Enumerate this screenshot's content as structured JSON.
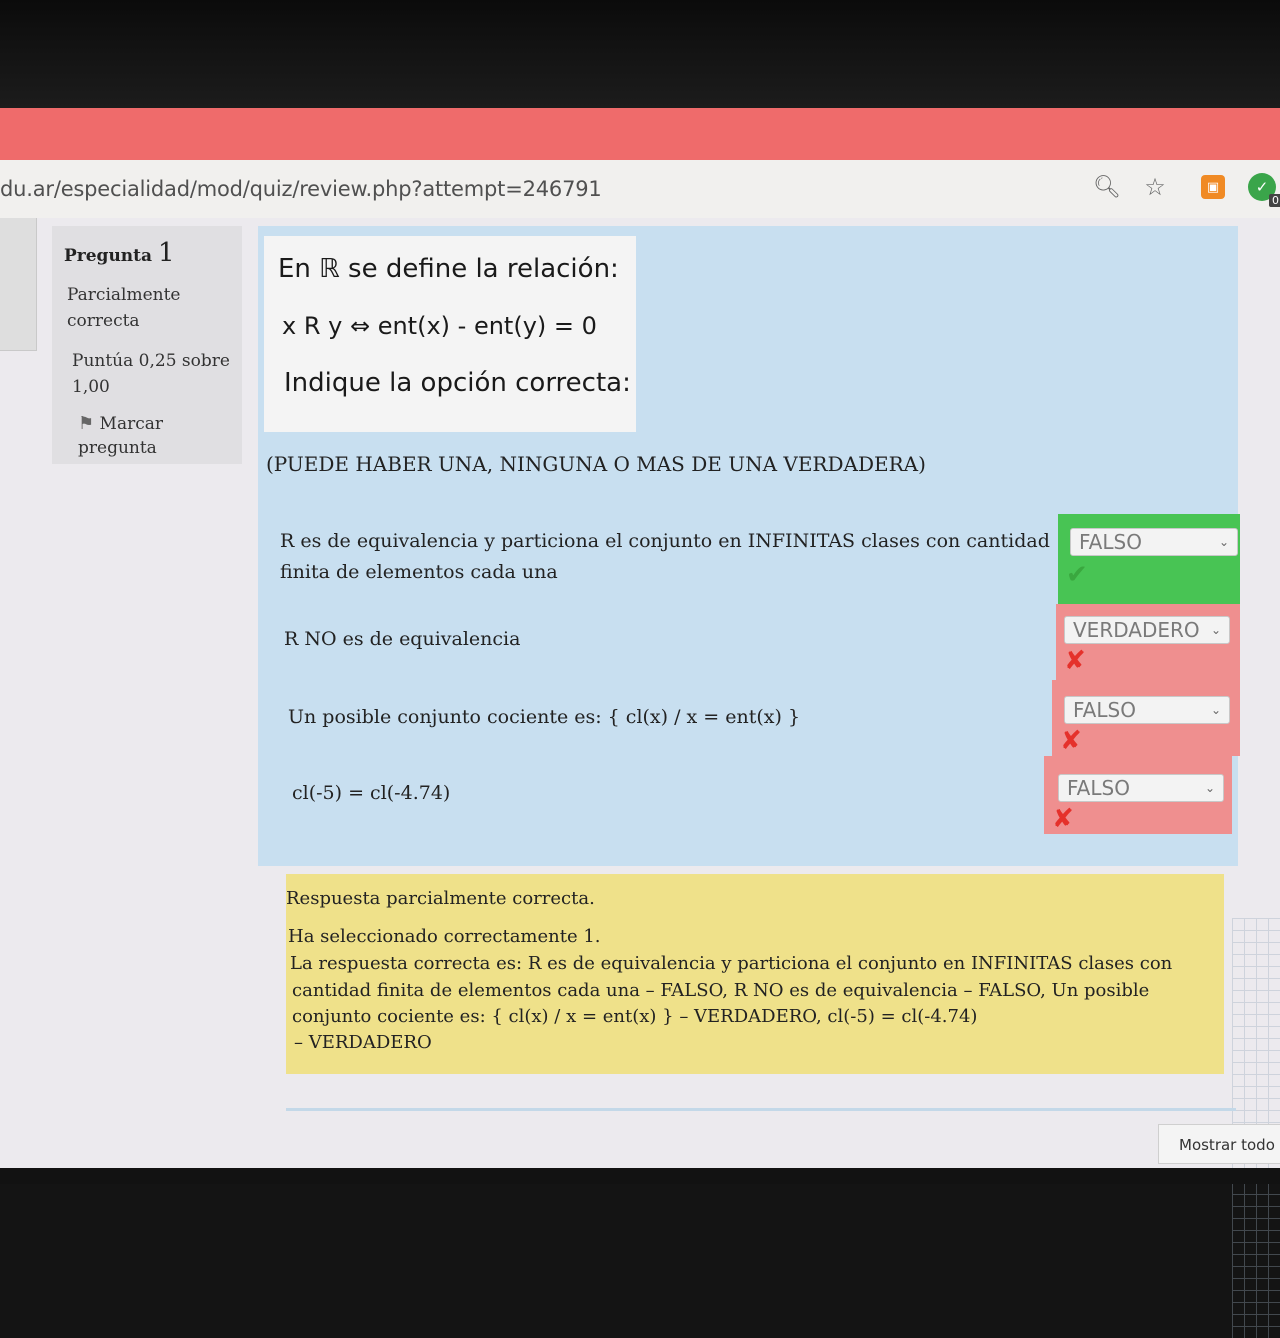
{
  "browser": {
    "url": "du.ar/especialidad/mod/quiz/review.php?attempt=246791",
    "icons": [
      "zoom-icon",
      "bookmark-star-icon",
      "extension-icon",
      "extension-badge-icon"
    ],
    "extension_badge": "0"
  },
  "question_info": {
    "label": "Pregunta",
    "number": "1",
    "state_line1": "Parcialmente",
    "state_line2": "correcta",
    "grade_line1": "Puntúa 0,25 sobre",
    "grade_line2": "1,00",
    "flag_line1": "Marcar",
    "flag_line2": "pregunta"
  },
  "question": {
    "image_lines": [
      "En ℝ se define la relación:",
      "x R y ⇔ ent(x) - ent(y) = 0",
      "Indique la opción correcta:"
    ],
    "note": "(PUEDE HABER UNA, NINGUNA O MAS DE UNA VERDADERA)",
    "items": [
      {
        "stem_line1": "R es de equivalencia y particiona el conjunto en INFINITAS clases con cantidad",
        "stem_line2": "finita de elementos cada una",
        "selected": "FALSO",
        "result": "correct",
        "mark": "✔"
      },
      {
        "stem_line1": "R NO es de equivalencia",
        "stem_line2": "",
        "selected": "VERDADERO",
        "result": "incorrect",
        "mark": "✘"
      },
      {
        "stem_line1": "Un posible conjunto cociente es:  { cl(x) / x = ent(x)  }",
        "stem_line2": "",
        "selected": "FALSO",
        "result": "incorrect",
        "mark": "✘"
      },
      {
        "stem_line1": "cl(-5) = cl(-4.74)",
        "stem_line2": "",
        "selected": "FALSO",
        "result": "incorrect",
        "mark": "✘"
      }
    ]
  },
  "feedback": {
    "status": "Respuesta parcialmente correcta.",
    "selected_count": "Ha seleccionado correctamente 1.",
    "correct_line1": "La respuesta correcta es: R es de equivalencia y particiona el conjunto en INFINITAS clases con",
    "correct_line2": "cantidad finita de elementos cada una – FALSO, R NO es de equivalencia – FALSO, Un posible",
    "correct_line3": "conjunto cociente es:  { cl(x) / x = ent(x)  } – VERDADERO, cl(-5) = cl(-4.74)",
    "correct_line4": "– VERDADERO"
  },
  "footer": {
    "show_all_label": "Mostrar todo"
  },
  "colors": {
    "correct_bg": "#48c454",
    "incorrect_bg": "#ef8f8f",
    "question_bg": "#c8dff0",
    "feedback_bg": "#efe18a",
    "browser_accent": "#ef6b6b"
  }
}
